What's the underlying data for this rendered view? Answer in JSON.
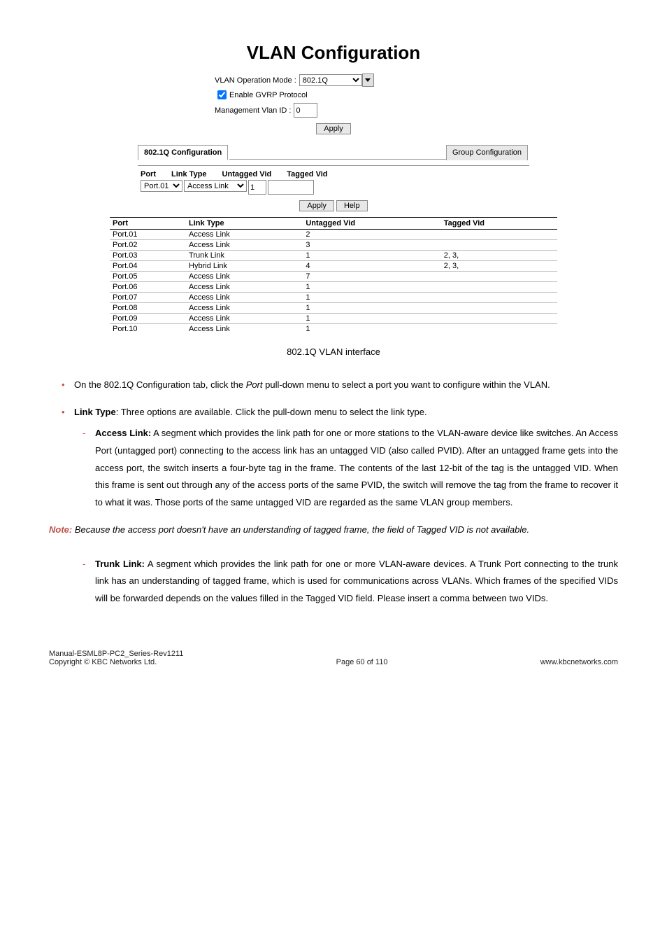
{
  "title": "VLAN Configuration",
  "top": {
    "mode_label": "VLAN Operation Mode :",
    "mode_value": "802.1Q",
    "gvrp_label": "Enable GVRP Protocol",
    "mgmt_label": "Management Vlan ID :",
    "mgmt_value": "0",
    "apply": "Apply"
  },
  "tabs": {
    "active": "802.1Q Configuration",
    "other": "Group Configuration"
  },
  "config_row": {
    "port_label": "Port",
    "link_label": "Link Type",
    "untagged_label": "Untagged Vid",
    "tagged_label": "Tagged Vid",
    "port_value": "Port.01",
    "link_value": "Access Link",
    "untagged_value": "1",
    "apply": "Apply",
    "help": "Help"
  },
  "table_headers": {
    "c1": "Port",
    "c2": "Link Type",
    "c3": "Untagged Vid",
    "c4": "Tagged Vid"
  },
  "rows": [
    {
      "port": "Port.01",
      "link": "Access Link",
      "uv": "2",
      "tv": ""
    },
    {
      "port": "Port.02",
      "link": "Access Link",
      "uv": "3",
      "tv": ""
    },
    {
      "port": "Port.03",
      "link": "Trunk Link",
      "uv": "1",
      "tv": "2, 3,"
    },
    {
      "port": "Port.04",
      "link": "Hybrid Link",
      "uv": "4",
      "tv": "2, 3,"
    },
    {
      "port": "Port.05",
      "link": "Access Link",
      "uv": "7",
      "tv": ""
    },
    {
      "port": "Port.06",
      "link": "Access Link",
      "uv": "1",
      "tv": ""
    },
    {
      "port": "Port.07",
      "link": "Access Link",
      "uv": "1",
      "tv": ""
    },
    {
      "port": "Port.08",
      "link": "Access Link",
      "uv": "1",
      "tv": ""
    },
    {
      "port": "Port.09",
      "link": "Access Link",
      "uv": "1",
      "tv": ""
    },
    {
      "port": "Port.10",
      "link": "Access Link",
      "uv": "1",
      "tv": ""
    }
  ],
  "caption": "802.1Q VLAN interface",
  "body": {
    "b1a": "On the 802.1Q Configuration tab, click the ",
    "b1b": "Port",
    "b1c": " pull-down menu to select a port you want to configure within the VLAN.",
    "b2a": "Link Type",
    "b2b": ": Three options are available. Click the pull-down menu to select the link type.",
    "accessHead": "Access Link:",
    "accessBody": " A segment which provides the link path for one or more stations to the VLAN-aware device like switches. An Access Port (untagged port) connecting to the access link has an untagged VID (also called PVID). After an untagged frame gets into the access port, the switch inserts a four-byte tag in the frame. The contents of the last 12-bit of the tag is the untagged VID. When this frame is sent out through any of the access ports of the same PVID, the switch will remove the tag from the frame to recover it to what it was. Those ports of the same untagged VID are regarded as the same VLAN group members.",
    "noteLabel": "Note:",
    "noteBody": " Because the access port doesn't have an understanding of tagged frame, the field of Tagged VID is not available.",
    "trunkHead": "Trunk Link:",
    "trunkBody": " A segment which provides the link path for one or more VLAN-aware devices. A Trunk Port connecting to the trunk link has an understanding of tagged frame, which is used for communications across VLANs. Which frames of the specified VIDs will be forwarded depends on the values filled in the Tagged VID field. Please insert a comma between two VIDs."
  },
  "footer": {
    "left1": "Manual-ESML8P-PC2_Series-Rev1211",
    "left2": "Copyright © KBC Networks Ltd.",
    "center": "Page 60 of 110",
    "right": "www.kbcnetworks.com"
  }
}
